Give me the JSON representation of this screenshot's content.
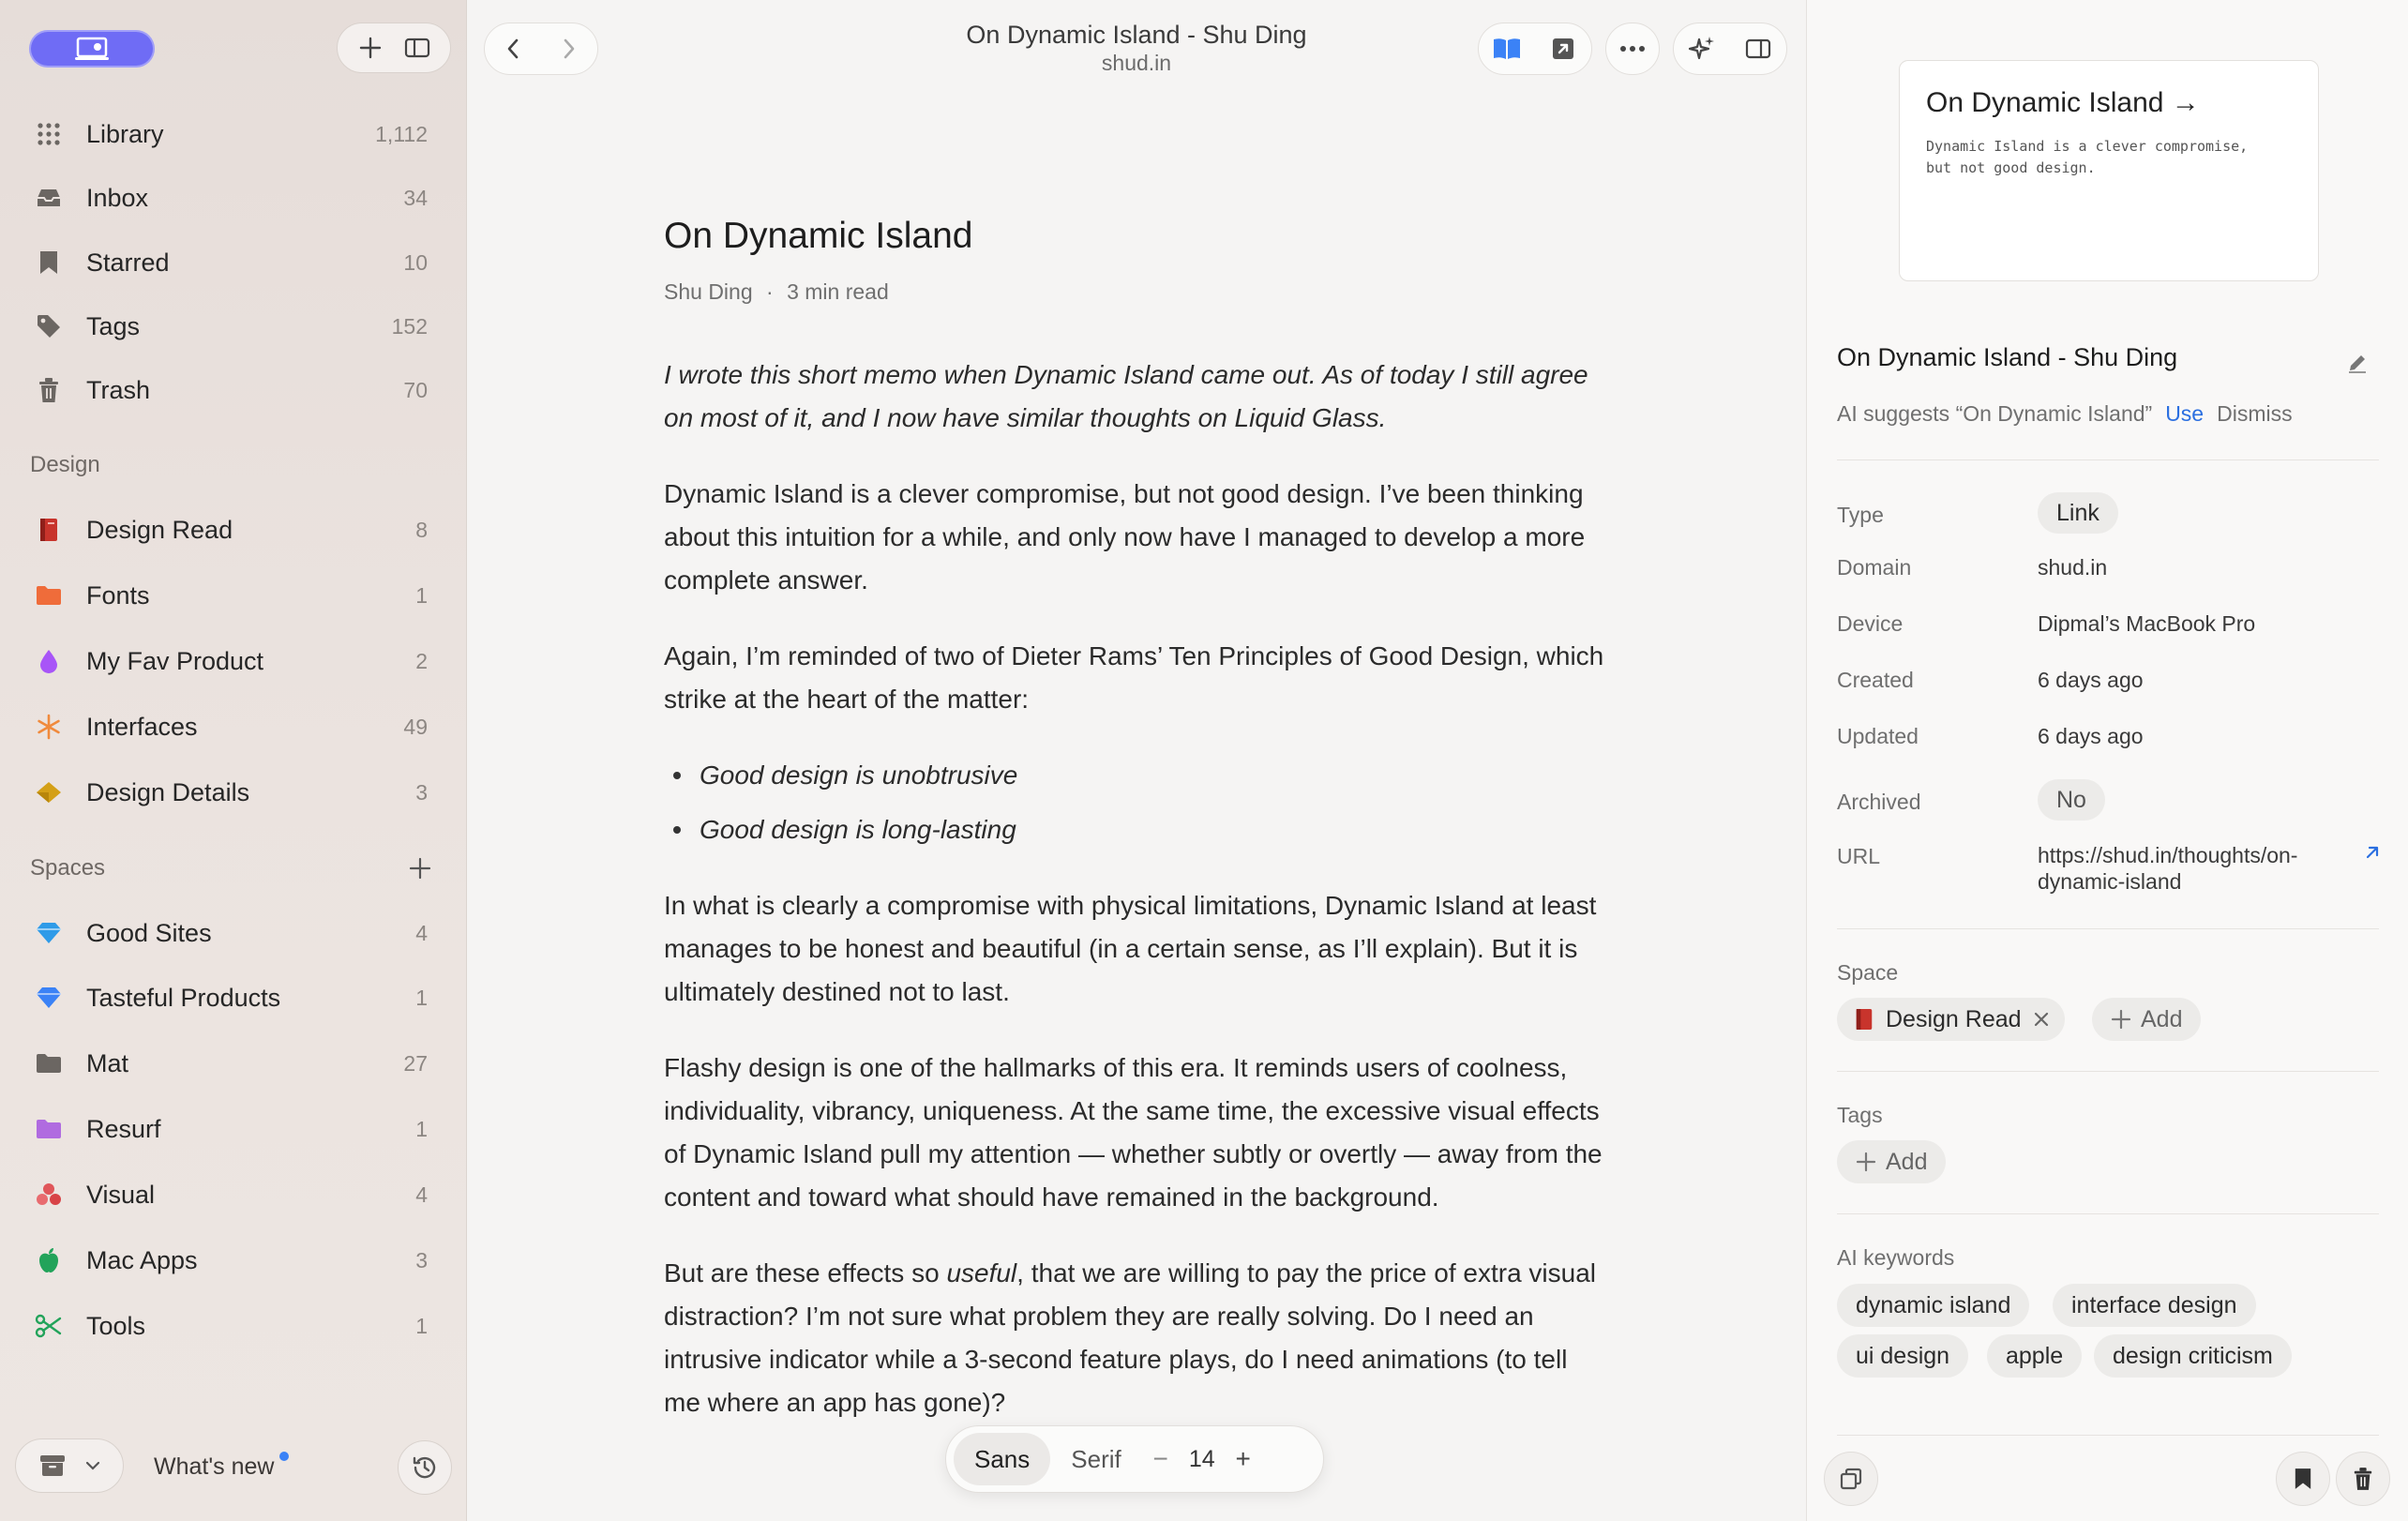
{
  "sidebar": {
    "items": [
      {
        "label": "Library",
        "count": "1,112",
        "icon": "grid-icon"
      },
      {
        "label": "Inbox",
        "count": "34",
        "icon": "inbox-icon"
      },
      {
        "label": "Starred",
        "count": "10",
        "icon": "bookmark-icon"
      },
      {
        "label": "Tags",
        "count": "152",
        "icon": "tag-icon"
      },
      {
        "label": "Trash",
        "count": "70",
        "icon": "trash-icon"
      }
    ],
    "design_title": "Design",
    "design_items": [
      {
        "label": "Design Read",
        "count": "8",
        "icon": "book-icon",
        "color": "#c8342c"
      },
      {
        "label": "Fonts",
        "count": "1",
        "icon": "folder-icon",
        "color": "#ef6c3a"
      },
      {
        "label": "My Fav Product",
        "count": "2",
        "icon": "drop-icon",
        "color": "#a855f7"
      },
      {
        "label": "Interfaces",
        "count": "49",
        "icon": "asterisk-icon",
        "color": "#f08a3c"
      },
      {
        "label": "Design Details",
        "count": "3",
        "icon": "diamond-icon",
        "color": "#d4a017"
      }
    ],
    "spaces_title": "Spaces",
    "space_items": [
      {
        "label": "Good Sites",
        "count": "4",
        "icon": "gem-icon",
        "color": "#2f9be8"
      },
      {
        "label": "Tasteful Products",
        "count": "1",
        "icon": "gem-icon",
        "color": "#3b82f6"
      },
      {
        "label": "Mat",
        "count": "27",
        "icon": "folder-icon",
        "color": "#6b6662"
      },
      {
        "label": "Resurf",
        "count": "1",
        "icon": "folder-icon",
        "color": "#b06be0"
      },
      {
        "label": "Visual",
        "count": "4",
        "icon": "circles-icon",
        "color": "#e0565a"
      },
      {
        "label": "Mac Apps",
        "count": "3",
        "icon": "apple-icon",
        "color": "#22a35a"
      },
      {
        "label": "Tools",
        "count": "1",
        "icon": "scissors-icon",
        "color": "#22a35a"
      }
    ],
    "whats_new": "What's new"
  },
  "window": {
    "title": "On Dynamic Island - Shu Ding",
    "subtitle": "shud.in"
  },
  "article": {
    "title": "On Dynamic Island",
    "author": "Shu Ding",
    "sep": "·",
    "read_time": "3 min read",
    "intro": "I wrote this short memo when Dynamic Island came out. As of today I still agree on most of it, and I now have similar thoughts on Liquid Glass.",
    "p1": "Dynamic Island is a clever compromise, but not good design. I’ve been thinking about this intuition for a while, and only now have I managed to develop a more complete answer.",
    "p2": "Again, I’m reminded of two of Dieter Rams’ Ten Principles of Good Design, which strike at the heart of the matter:",
    "bullet1": "Good design is unobtrusive",
    "bullet2": "Good design is long-lasting",
    "p3": "In what is clearly a compromise with physical limitations, Dynamic Island at least manages to be honest and beautiful (in a certain sense, as I’ll explain). But it is ultimately destined not to last.",
    "p4": "Flashy design is one of the hallmarks of this era. It reminds users of coolness, individuality, vibrancy, uniqueness. At the same time, the excessive visual effects of Dynamic Island pull my attention — whether subtly or overtly — away from the content and toward what should have remained in the background.",
    "p5_a": "But are these effects so ",
    "p5_em": "useful",
    "p5_b": ", that we are willing to pay the price of extra visual distraction? I’m not sure what problem they are really solving. Do I need an intrusive indicator while a 3-second feature plays, do I need animations (to tell me where an app has gone)?"
  },
  "fontbar": {
    "sans": "Sans",
    "serif": "Serif",
    "minus": "−",
    "size": "14",
    "plus": "+"
  },
  "inspector": {
    "preview_title": "On Dynamic Island →",
    "preview_text": "Dynamic Island is a clever compromise, but not good design.",
    "title": "On Dynamic Island - Shu Ding",
    "ai_suggests": "AI suggests “On Dynamic Island”",
    "use": "Use",
    "dismiss": "Dismiss",
    "props": {
      "type_label": "Type",
      "type_value": "Link",
      "domain_label": "Domain",
      "domain_value": "shud.in",
      "device_label": "Device",
      "device_value": "Dipmal’s MacBook Pro",
      "created_label": "Created",
      "created_value": "6 days ago",
      "updated_label": "Updated",
      "updated_value": "6 days ago",
      "archived_label": "Archived",
      "archived_value": "No",
      "url_label": "URL",
      "url_value": "https://shud.in/thoughts/on-dynamic-island"
    },
    "space_label": "Space",
    "space_chip": "Design Read",
    "add": "Add",
    "tags_label": "Tags",
    "ai_keywords_label": "AI keywords",
    "keywords": [
      "dynamic island",
      "interface design",
      "ui design",
      "apple",
      "design criticism"
    ]
  },
  "colors": {
    "accent": "#6f6cf5",
    "link": "#2b6fe0"
  }
}
